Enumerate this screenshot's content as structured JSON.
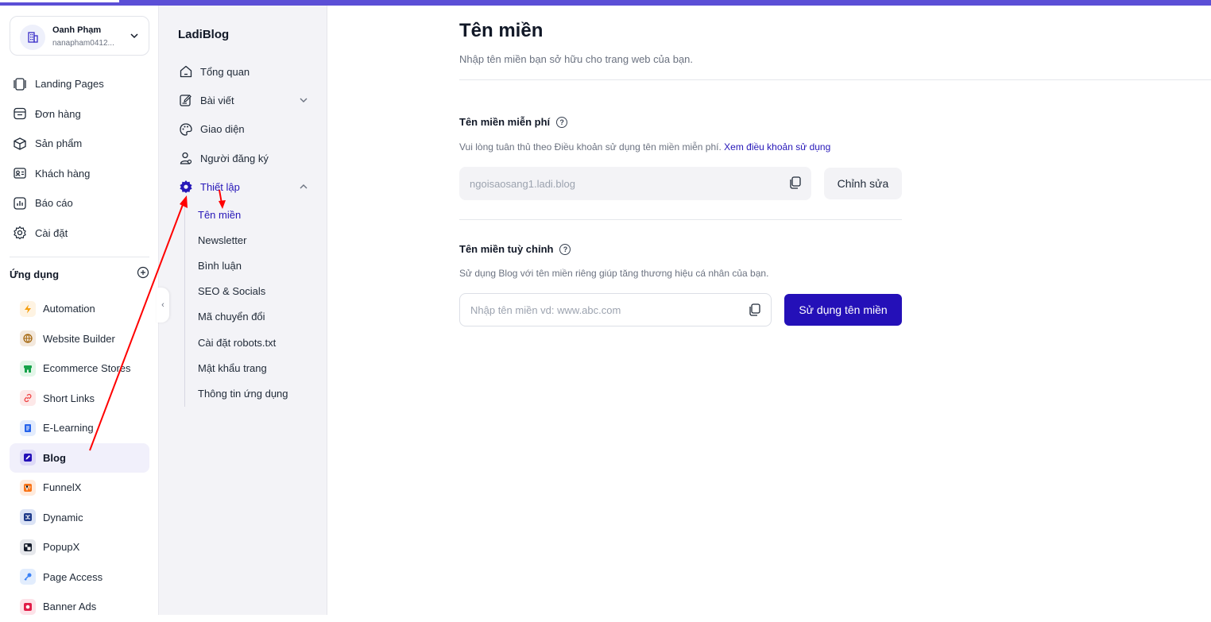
{
  "account": {
    "name": "Oanh Phạm",
    "email": "nanapham0412..."
  },
  "main_nav": [
    {
      "label": "Landing Pages",
      "icon": "landing-pages-icon"
    },
    {
      "label": "Đơn hàng",
      "icon": "orders-icon"
    },
    {
      "label": "Sản phẩm",
      "icon": "products-icon"
    },
    {
      "label": "Khách hàng",
      "icon": "customers-icon"
    },
    {
      "label": "Báo cáo",
      "icon": "reports-icon"
    },
    {
      "label": "Cài đặt",
      "icon": "settings-icon"
    }
  ],
  "apps": {
    "heading": "Ứng dụng",
    "items": [
      {
        "label": "Automation",
        "color": "#f59e0b",
        "bg": "#fef3e2"
      },
      {
        "label": "Website Builder",
        "color": "#a16207",
        "bg": "#f3e8dc"
      },
      {
        "label": "Ecommerce Stores",
        "color": "#16a34a",
        "bg": "#e3f6e9"
      },
      {
        "label": "Short Links",
        "color": "#ef4444",
        "bg": "#fde8e8"
      },
      {
        "label": "E-Learning",
        "color": "#2563eb",
        "bg": "#e3ecfd"
      },
      {
        "label": "Blog",
        "color": "#2410b8",
        "bg": "#ddd9f7",
        "active": true
      },
      {
        "label": "FunnelX",
        "color": "#f97316",
        "bg": "#ffeadb"
      },
      {
        "label": "Dynamic",
        "color": "#1e3a8a",
        "bg": "#dbe3f5"
      },
      {
        "label": "PopupX",
        "color": "#111827",
        "bg": "#e5e7eb"
      },
      {
        "label": "Page Access",
        "color": "#3b82f6",
        "bg": "#e2edfd"
      },
      {
        "label": "Banner Ads",
        "color": "#e11d48",
        "bg": "#fde2e8"
      }
    ]
  },
  "blog_nav": {
    "brand": "LadiBlog",
    "items": [
      {
        "label": "Tổng quan",
        "icon": "home-icon"
      },
      {
        "label": "Bài viết",
        "icon": "edit-icon"
      },
      {
        "label": "Giao diện",
        "icon": "palette-icon"
      },
      {
        "label": "Người đăng ký",
        "icon": "subscriber-icon"
      },
      {
        "label": "Thiết lập",
        "icon": "gear-icon",
        "active": true
      }
    ],
    "settings_items": [
      {
        "label": "Tên miền",
        "active": true
      },
      {
        "label": "Newsletter"
      },
      {
        "label": "Bình luận"
      },
      {
        "label": "SEO & Socials"
      },
      {
        "label": "Mã chuyển đổi"
      },
      {
        "label": "Cài đặt robots.txt"
      },
      {
        "label": "Mật khẩu trang"
      },
      {
        "label": "Thông tin ứng dụng"
      }
    ]
  },
  "page": {
    "title": "Tên miền",
    "description": "Nhập tên miền bạn sở hữu cho trang web của bạn."
  },
  "free_domain": {
    "title": "Tên miền miễn phí",
    "description": "Vui lòng tuân thủ theo Điều khoản sử dụng tên miền miễn phí.",
    "terms_link": "Xem điều khoản sử dụng",
    "value": "ngoisaosang1.ladi.blog",
    "edit_label": "Chỉnh sửa"
  },
  "custom_domain": {
    "title": "Tên miền tuỳ chỉnh",
    "description": "Sử dụng Blog với tên miền riêng giúp tăng thương hiệu cá nhân của bạn.",
    "placeholder": "Nhập tên miền vd: www.abc.com",
    "submit_label": "Sử dụng tên miền"
  },
  "colors": {
    "accent": "#2410b8",
    "annotation": "#ff0000"
  }
}
